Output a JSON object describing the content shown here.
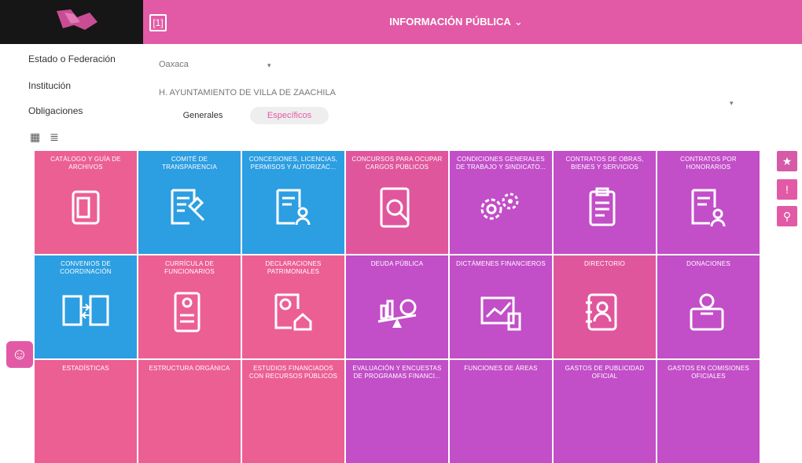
{
  "header": {
    "title": "INFORMACIÓN PÚBLICA",
    "title_chevron": "⌄",
    "nav_icon": "[1]"
  },
  "filters": {
    "estado_label": "Estado o Federación",
    "estado_value": "Oaxaca",
    "institucion_label": "Institución",
    "institucion_value": "H. AYUNTAMIENTO DE VILLA DE ZAACHILA",
    "obligaciones_label": "Obligaciones"
  },
  "tabs": {
    "generales": "Generales",
    "especificos": "Específicos"
  },
  "icons": {
    "grid_view": "▦",
    "list_view": "≣",
    "star": "★",
    "alert": "!",
    "search": "⚲",
    "accessibility": "☺"
  },
  "tiles": [
    {
      "title": "CATÁLOGO Y GUÍA DE ARCHIVOS",
      "color": "pink",
      "icon": "binder-icon"
    },
    {
      "title": "COMITÉ DE TRANSPARENCIA",
      "color": "blue",
      "icon": "gavel-doc-icon"
    },
    {
      "title": "CONCESIONES, LICENCIAS, PERMISOS Y AUTORIZAC...",
      "color": "blue",
      "icon": "doc-person-icon"
    },
    {
      "title": "CONCURSOS PARA OCUPAR CARGOS PÚBLICOS",
      "color": "rose",
      "icon": "doc-search-icon"
    },
    {
      "title": "CONDICIONES GENERALES DE TRABAJO Y SINDICATO...",
      "color": "magenta",
      "icon": "gears-icon"
    },
    {
      "title": "CONTRATOS DE OBRAS, BIENES Y SERVICIOS",
      "color": "magenta",
      "icon": "clipboard-icon"
    },
    {
      "title": "CONTRATOS POR HONORARIOS",
      "color": "magenta",
      "icon": "doc-user-icon"
    },
    {
      "title": "CONVENIOS DE COORDINACIÓN",
      "color": "blue",
      "icon": "exchange-docs-icon"
    },
    {
      "title": "CURRÍCULA DE FUNCIONARIOS",
      "color": "pink",
      "icon": "cv-icon"
    },
    {
      "title": "DECLARACIONES PATRIMONIALES",
      "color": "pink",
      "icon": "doc-house-icon"
    },
    {
      "title": "DEUDA PÚBLICA",
      "color": "magenta",
      "icon": "scale-money-icon"
    },
    {
      "title": "DICTÁMENES FINANCIEROS",
      "color": "magenta",
      "icon": "chart-calc-icon"
    },
    {
      "title": "DIRECTORIO",
      "color": "rose",
      "icon": "address-book-icon"
    },
    {
      "title": "DONACIONES",
      "color": "magenta",
      "icon": "donation-box-icon"
    },
    {
      "title": "ESTADÍSTICAS",
      "color": "pink",
      "icon": ""
    },
    {
      "title": "ESTRUCTURA ORGÁNICA",
      "color": "pink",
      "icon": ""
    },
    {
      "title": "ESTUDIOS FINANCIADOS CON RECURSOS PÚBLICOS",
      "color": "pink",
      "icon": ""
    },
    {
      "title": "EVALUACIÓN Y ENCUESTAS DE PROGRAMAS FINANCI...",
      "color": "magenta",
      "icon": ""
    },
    {
      "title": "FUNCIONES DE ÁREAS",
      "color": "magenta",
      "icon": ""
    },
    {
      "title": "GASTOS DE PUBLICIDAD OFICIAL",
      "color": "magenta",
      "icon": ""
    },
    {
      "title": "GASTOS EN COMISIONES OFICIALES",
      "color": "magenta",
      "icon": ""
    }
  ]
}
